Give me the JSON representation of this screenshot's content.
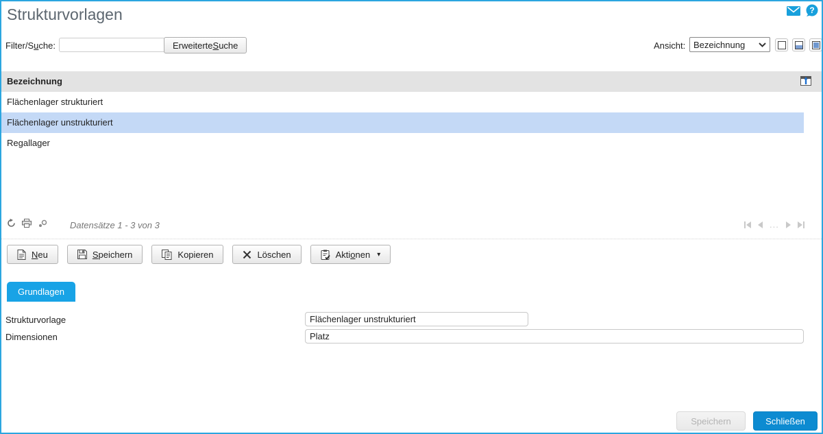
{
  "page": {
    "title": "Strukturvorlagen"
  },
  "topbar": {
    "help_glyph": "?"
  },
  "filter": {
    "label_pre": "Filter/S",
    "label_key": "u",
    "label_post": "che:",
    "input_value": "",
    "advanced_pre": "Erweiterte ",
    "advanced_key": "S",
    "advanced_post": "uche"
  },
  "view": {
    "label": "Ansicht:",
    "selected": "Bezeichnung"
  },
  "table": {
    "header": "Bezeichnung",
    "rows": [
      {
        "label": "Flächenlager strukturiert",
        "selected": false
      },
      {
        "label": "Flächenlager unstrukturiert",
        "selected": true
      },
      {
        "label": "Regallager",
        "selected": false
      }
    ]
  },
  "pagination": {
    "status": "Datensätze 1 - 3 von 3",
    "ellipsis": "..."
  },
  "toolbar": {
    "buttons": [
      {
        "pre": "",
        "key": "N",
        "post": "eu",
        "icon": "new-document-icon"
      },
      {
        "pre": "",
        "key": "S",
        "post": "peichern",
        "icon": "save-icon"
      },
      {
        "pre": "Kopieren",
        "key": "",
        "post": "",
        "icon": "copy-icon"
      },
      {
        "pre": "Löschen",
        "key": "",
        "post": "",
        "icon": "delete-icon"
      },
      {
        "pre": "Akti",
        "key": "o",
        "post": "nen",
        "icon": "actions-icon",
        "caret": "▾"
      }
    ]
  },
  "tabs": {
    "grundlagen": "Grundlagen"
  },
  "form": {
    "fields": [
      {
        "label": "Strukturvorlage",
        "value": "Flächenlager unstrukturiert"
      },
      {
        "label": "Dimensionen",
        "value": "Platz"
      }
    ]
  },
  "footer": {
    "save": "Speichern",
    "close": "Schließen"
  },
  "colors": {
    "accent_blue": "#18a0dc",
    "selection": "#c4d9f6",
    "tab_blue": "#18a3e6",
    "close_button": "#0d8bd1",
    "page_border": "#2ca6e0"
  }
}
